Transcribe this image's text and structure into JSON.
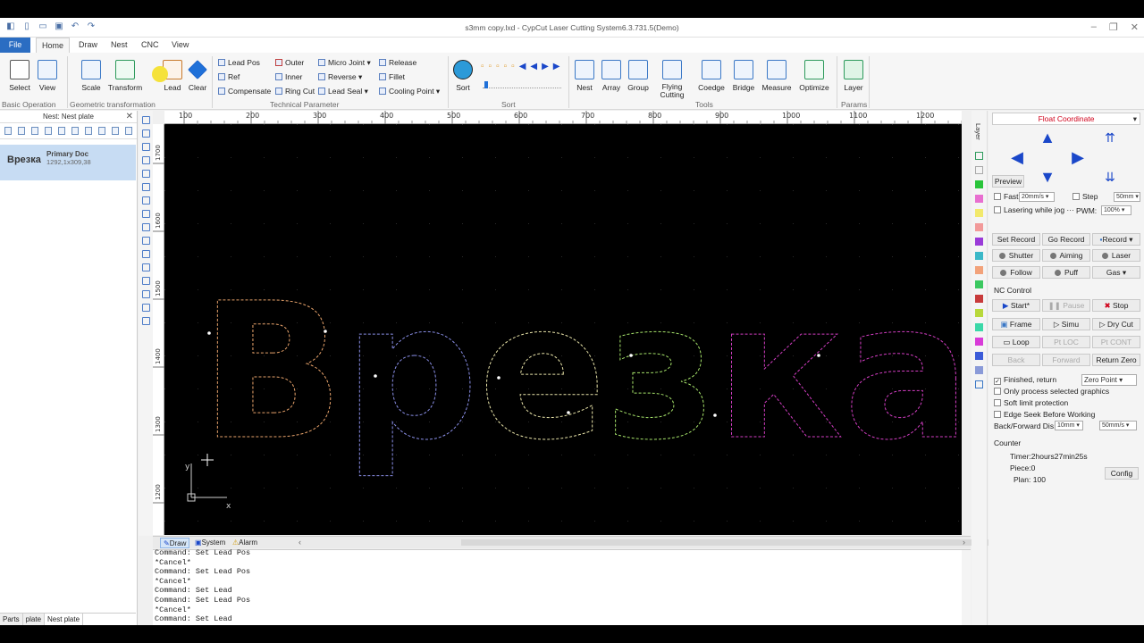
{
  "window": {
    "title": "s3mm copy.lxd - CypCut Laser Cutting System6.3.731.5(Demo)"
  },
  "menu": {
    "file": "File",
    "tabs": [
      "Home",
      "Draw",
      "Nest",
      "CNC",
      "View"
    ],
    "active_tab": "Home"
  },
  "ribbon": {
    "select": "Select",
    "view": "View",
    "scale": "Scale",
    "transform": "Transform",
    "lead": "Lead",
    "clear": "Clear",
    "lead_pos": "Lead Pos",
    "ref": "Ref",
    "compensate": "Compensate",
    "outer": "Outer",
    "inner": "Inner",
    "ring_cut": "Ring Cut",
    "micro_joint": "Micro Joint",
    "reverse": "Reverse",
    "lead_seal": "Lead Seal",
    "release": "Release",
    "fillet": "Fillet",
    "cooling_point": "Cooling Point",
    "sort": "Sort",
    "nest": "Nest",
    "array": "Array",
    "group": "Group",
    "flying_cutting": "Flying Cutting",
    "coedge": "Coedge",
    "bridge": "Bridge",
    "measure": "Measure",
    "optimize": "Optimize",
    "layer": "Layer",
    "groups": {
      "basic_operation": "Basic Operation",
      "geometric_transformation": "Geometric transformation",
      "technical_parameter": "Technical Parameter",
      "sort": "Sort",
      "tools": "Tools",
      "params": "Params"
    }
  },
  "left_panel": {
    "header": "Nest: Nest plate",
    "item_glyph": "Врезка",
    "item_title": "Primary Doc",
    "item_size": "1292,1x309,38",
    "bottom_tabs": [
      "Parts",
      "plate",
      "Nest plate"
    ],
    "active_bottom_tab": "Nest plate"
  },
  "rulers": {
    "h_ticks": [
      "100",
      "200",
      "300",
      "400",
      "500",
      "600",
      "700",
      "800",
      "900",
      "1000",
      "1100",
      "1200"
    ],
    "v_ticks": [
      "1700",
      "1600",
      "1500",
      "1400",
      "1300",
      "1200"
    ]
  },
  "canvas": {
    "word": "Врезка",
    "axis_x": "x",
    "axis_y": "y",
    "colors": {
      "letter1": "#e8a36b",
      "letter2": "#8a8fe8",
      "letter3": "#e8e3a8",
      "letter4": "#a6e36a",
      "letter5": "#d43ec4"
    }
  },
  "bottom_tabs": [
    "Draw",
    "System",
    "Alarm"
  ],
  "active_bottom_tab": "Draw",
  "command_log": [
    "Command: Set Lead Pos",
    "*Cancel*",
    "Command: Set Lead Pos",
    "*Cancel*",
    "Command: Set Lead",
    "Command: Set Lead Pos",
    "*Cancel*",
    "Command: Set Lead"
  ],
  "side_strip": {
    "label": "Layer"
  },
  "right_panel": {
    "header": "Float Coordinate",
    "preview": "Preview",
    "fast": "Fast",
    "fast_speed": "20mm/s",
    "step": "Step",
    "step_value": "50mm",
    "lasering_while_jog": "Lasering while jog",
    "pwm_label": "PWM:",
    "pwm_value": "100%",
    "set_record": "Set Record",
    "go_record": "Go Record",
    "record": "Record",
    "shutter": "Shutter",
    "aiming": "Aiming",
    "laser": "Laser",
    "follow": "Follow",
    "puff": "Puff",
    "gas": "Gas",
    "nc_control": "NC Control",
    "start": "Start*",
    "pause": "Pause",
    "stop": "Stop",
    "frame": "Frame",
    "simu": "Simu",
    "dry_cut": "Dry Cut",
    "loop": "Loop",
    "pt_loc": "Pt LOC",
    "pt_cont": "Pt CONT",
    "back": "Back",
    "forward": "Forward",
    "return_zero": "Return Zero",
    "finished_return": "Finished, return",
    "zero_point": "Zero Point",
    "only_process_selected": "Only process selected graphics",
    "soft_limit": "Soft limit protection",
    "edge_seek": "Edge Seek Before Working",
    "back_forward_dis": "Back/Forward Dis:",
    "bf_dis_value": "10mm",
    "bf_speed_value": "50mm/s",
    "counter": "Counter",
    "timer": "Timer:2hours27min25s",
    "piece": "Piece:0",
    "plan": "Plan: 100",
    "config": "Config"
  }
}
